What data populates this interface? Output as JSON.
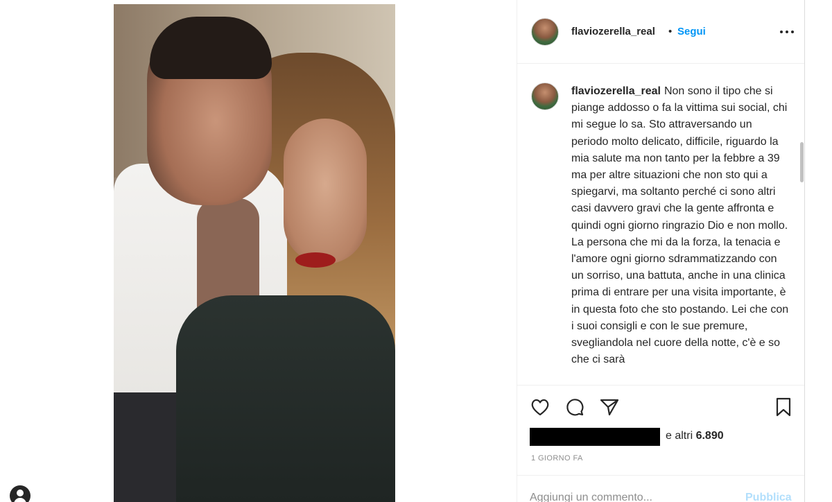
{
  "post": {
    "username": "flaviozerella_real",
    "follow_separator": "•",
    "follow_label": "Segui",
    "more_icon": "more-options-icon",
    "photo_alt": "selfie of couple"
  },
  "caption": {
    "username": "flaviozerella_real",
    "text": "Non sono il tipo che si piange addosso o fa la vittima sui social, chi mi segue lo sa. Sto attraversando un periodo molto delicato, difficile, riguardo la mia salute ma non tanto per la febbre a 39 ma per altre situazioni che non sto qui a spiegarvi, ma soltanto perché ci sono altri casi davvero gravi che la gente affronta e quindi ogni giorno ringrazio Dio e non mollo. La persona che mi da la forza, la tenacia e l'amore ogni giorno sdrammatizzando con un sorriso, una battuta, anche in una clinica prima di entrare per una visita importante, è in questa foto che sto postando. Lei che con i suoi consigli e con le sue premure, svegliandola nel cuore della notte, c'è e so che ci sarà"
  },
  "actions": {
    "icons": [
      "heart-icon",
      "comment-icon",
      "share-icon",
      "bookmark-icon"
    ]
  },
  "likes": {
    "prefix": "e altri",
    "count": "6.890"
  },
  "time_ago": "1 GIORNO FA",
  "comment": {
    "placeholder": "Aggiungi un commento...",
    "publish_label": "Pubblica"
  },
  "colors": {
    "link_blue": "#0095f6",
    "publish_disabled": "#b2dffc",
    "text": "#262626",
    "muted": "#8e8e8e"
  }
}
